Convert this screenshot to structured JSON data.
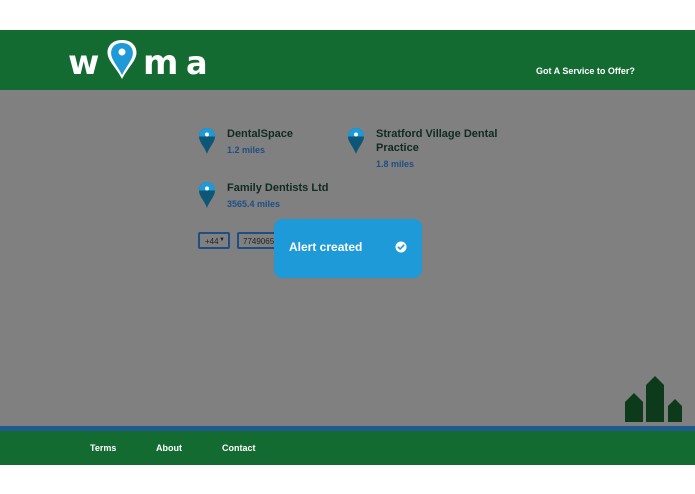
{
  "header": {
    "logo_letters": [
      "w",
      "m",
      "a"
    ],
    "link_label": "Got A Service to Offer?"
  },
  "results": [
    {
      "name": "DentalSpace",
      "distance": "1.2 miles"
    },
    {
      "name": "Stratford Village Dental Practice",
      "distance": "1.8 miles"
    },
    {
      "name": "Family Dentists Ltd",
      "distance": "3565.4 miles"
    }
  ],
  "alert_form": {
    "country_code": "+44",
    "phone_value": "7749065"
  },
  "toast": {
    "message": "Alert created"
  },
  "footer": {
    "links": [
      "Terms",
      "About",
      "Contact"
    ]
  },
  "colors": {
    "brand_green": "#136b32",
    "accent_blue": "#1e9ad9",
    "overlay_gray": "#808080",
    "dark_blue": "#1f4e86"
  }
}
